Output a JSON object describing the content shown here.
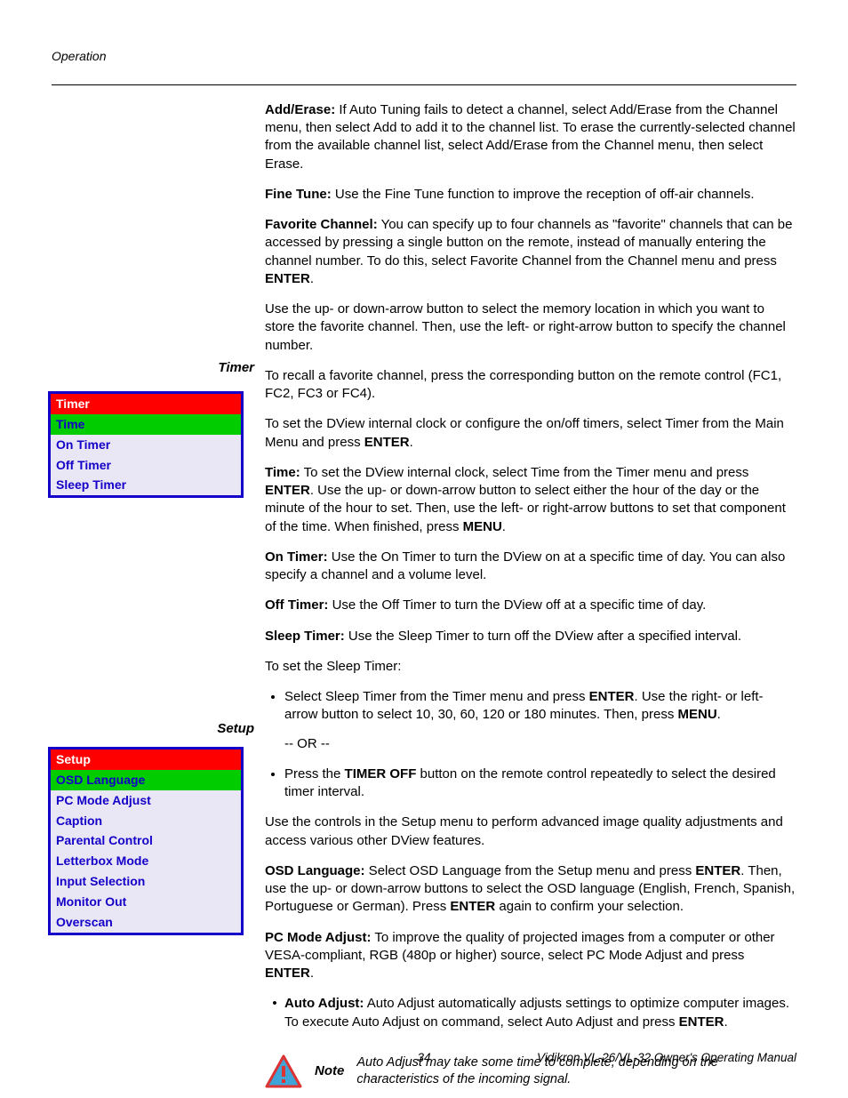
{
  "header": {
    "section": "Operation"
  },
  "sidebar": {
    "labels": {
      "timer": "Timer",
      "setup": "Setup"
    },
    "timer_menu": {
      "title": "Timer",
      "highlight": "Time",
      "items": [
        "On Timer",
        "Off Timer",
        "Sleep Timer"
      ]
    },
    "setup_menu": {
      "title": "Setup",
      "highlight": "OSD Language",
      "items": [
        "PC Mode Adjust",
        "Caption",
        "Parental Control",
        "Letterbox Mode",
        "Input Selection",
        "Monitor Out",
        "Overscan"
      ]
    }
  },
  "content": {
    "add_erase": {
      "label": "Add/Erase:",
      "text": " If Auto Tuning fails to detect a channel, select Add/Erase from the Channel menu, then select Add to add it to the channel list. To erase the currently-selected channel from the available channel list, select Add/Erase from the Channel menu, then select Erase."
    },
    "fine_tune": {
      "label": "Fine Tune:",
      "text": " Use the Fine Tune function to improve the reception of off-air channels."
    },
    "fav_channel": {
      "label": "Favorite Channel:",
      "text_a": " You can specify up to four channels as \"favorite\" channels that can be accessed by pressing a single button on the remote, instead of manually entering the channel number. To do this, select Favorite Channel from the Channel menu and press ",
      "enter": "ENTER",
      "period": "."
    },
    "fav2": "Use the up- or down-arrow button to select the memory location in which you want to store the favorite channel. Then, use the left- or right-arrow button to specify the channel number.",
    "fav3": "To recall a favorite channel, press the corresponding button on the remote control (FC1, FC2, FC3 or FC4).",
    "timer_intro": {
      "text_a": "To set the DView internal clock or configure the on/off timers, select Timer from the Main Menu and press ",
      "enter": "ENTER",
      "period": "."
    },
    "time": {
      "label": "Time:",
      "text_a": " To set the DView internal clock, select Time from the Timer menu and press ",
      "enter": "ENTER",
      "text_b": ". Use the up- or down-arrow button to select either the hour of the day or the minute of the hour to set. Then, use the left- or right-arrow buttons to set that component of the time. When finished, press ",
      "menu": "MENU",
      "period": "."
    },
    "on_timer": {
      "label": "On Timer:",
      "text": " Use the On Timer to turn the DView on at a specific time of day. You can also specify a channel and a volume level."
    },
    "off_timer": {
      "label": "Off Timer:",
      "text": " Use the Off Timer to turn the DView off at a specific time of day."
    },
    "sleep_timer": {
      "label": "Sleep Timer:",
      "text": " Use the Sleep Timer to turn off the DView after a specified interval."
    },
    "sleep_intro": "To set the Sleep Timer:",
    "sleep_b1": {
      "text_a": "Select Sleep Timer from the Timer menu and press ",
      "enter": "ENTER",
      "text_b": ". Use the right- or left-arrow button to select 10, 30, 60, 120 or 180 minutes. Then, press ",
      "menu": "MENU",
      "period": "."
    },
    "sleep_or": "-- OR --",
    "sleep_b2": {
      "text_a": "Press the ",
      "btn": "TIMER OFF",
      "text_b": " button on the remote control repeatedly to select the desired timer interval."
    },
    "setup_intro": "Use the controls in the Setup menu to perform advanced image quality adjustments and access various other DView features.",
    "osd": {
      "label": "OSD Language:",
      "text_a": " Select OSD Language from the Setup menu and press ",
      "enter": "ENTER",
      "text_b": ". Then, use the up- or down-arrow buttons to select the OSD language (English, French, Spanish, Portuguese or German). Press ",
      "enter2": "ENTER",
      "text_c": " again to confirm your selection."
    },
    "pcmode": {
      "label": "PC Mode Adjust:",
      "text_a": " To improve the quality of projected images from a computer or other VESA-compliant, RGB (480p or higher) source, select PC Mode Adjust and press ",
      "enter": "ENTER",
      "period": "."
    },
    "autoadj": {
      "label": "Auto Adjust:",
      "text_a": " Auto Adjust automatically adjusts settings to optimize computer images. To execute Auto Adjust on command, select Auto Adjust and press ",
      "enter": "ENTER",
      "period": "."
    },
    "note": {
      "label": "Note",
      "text": "Auto Adjust may take some time to complete, depending on the characteristics of the incoming signal."
    }
  },
  "footer": {
    "page": "34",
    "doc": "Vidikron VL-26/VL-32 Owner's Operating Manual"
  }
}
